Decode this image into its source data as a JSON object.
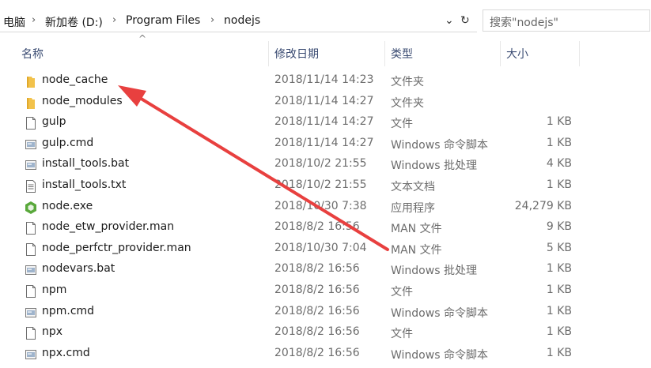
{
  "address": {
    "crumbs": [
      "电脑",
      "新加卷 (D:)",
      "Program Files",
      "nodejs"
    ],
    "dropdown_glyph": "⌄",
    "refresh_glyph": "↻"
  },
  "search": {
    "placeholder": "搜索\"nodejs\""
  },
  "columns": {
    "name": "名称",
    "date": "修改日期",
    "type": "类型",
    "size": "大小",
    "sort_glyph": "^"
  },
  "files": [
    {
      "name": "node_cache",
      "date": "2018/11/14 14:23",
      "type": "文件夹",
      "size": "",
      "icon": "folder-icon"
    },
    {
      "name": "node_modules",
      "date": "2018/11/14 14:27",
      "type": "文件夹",
      "size": "",
      "icon": "folder-icon"
    },
    {
      "name": "gulp",
      "date": "2018/11/14 14:27",
      "type": "文件",
      "size": "1 KB",
      "icon": "file-icon"
    },
    {
      "name": "gulp.cmd",
      "date": "2018/11/14 14:27",
      "type": "Windows 命令脚本",
      "size": "1 KB",
      "icon": "script-icon"
    },
    {
      "name": "install_tools.bat",
      "date": "2018/10/2 21:55",
      "type": "Windows 批处理",
      "size": "4 KB",
      "icon": "script-icon"
    },
    {
      "name": "install_tools.txt",
      "date": "2018/10/2 21:55",
      "type": "文本文档",
      "size": "1 KB",
      "icon": "text-file-icon"
    },
    {
      "name": "node.exe",
      "date": "2018/10/30 7:38",
      "type": "应用程序",
      "size": "24,279 KB",
      "icon": "nodejs-app-icon"
    },
    {
      "name": "node_etw_provider.man",
      "date": "2018/8/2 16:56",
      "type": "MAN 文件",
      "size": "9 KB",
      "icon": "file-icon"
    },
    {
      "name": "node_perfctr_provider.man",
      "date": "2018/10/30 7:04",
      "type": "MAN 文件",
      "size": "5 KB",
      "icon": "file-icon"
    },
    {
      "name": "nodevars.bat",
      "date": "2018/8/2 16:56",
      "type": "Windows 批处理",
      "size": "1 KB",
      "icon": "script-icon"
    },
    {
      "name": "npm",
      "date": "2018/8/2 16:56",
      "type": "文件",
      "size": "1 KB",
      "icon": "file-icon"
    },
    {
      "name": "npm.cmd",
      "date": "2018/8/2 16:56",
      "type": "Windows 命令脚本",
      "size": "1 KB",
      "icon": "script-icon"
    },
    {
      "name": "npx",
      "date": "2018/8/2 16:56",
      "type": "文件",
      "size": "1 KB",
      "icon": "file-icon"
    },
    {
      "name": "npx.cmd",
      "date": "2018/8/2 16:56",
      "type": "Windows 命令脚本",
      "size": "1 KB",
      "icon": "script-icon"
    }
  ],
  "colors": {
    "arrow": "#e8403f",
    "folder": "#f2c24b",
    "node_green": "#59a83b",
    "header_text": "#3a4b72"
  }
}
